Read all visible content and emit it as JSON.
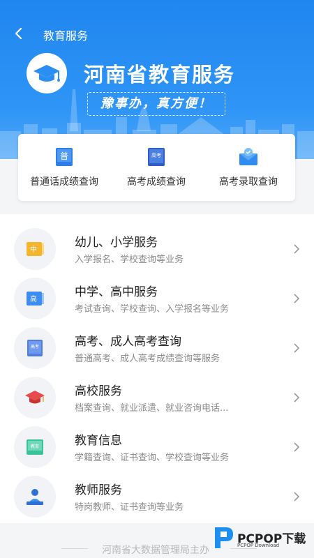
{
  "header": {
    "back": "back-arrow-icon",
    "title": "教育服务"
  },
  "banner": {
    "title": "河南省教育服务",
    "slogan": "豫事办，真方便！",
    "logo": "graduation-cap-icon"
  },
  "quick_links": [
    {
      "label": "普通话成绩查询",
      "icon": "mandarin-book-icon",
      "icon_text": "普"
    },
    {
      "label": "高考成绩查询",
      "icon": "exam-book-icon",
      "icon_text": "高考"
    },
    {
      "label": "高考录取查询",
      "icon": "envelope-check-icon"
    }
  ],
  "services": [
    {
      "title": "幼儿、小学服务",
      "subtitle": "入学报名、学校查询等业务",
      "icon": "primary-school-icon",
      "icon_text": "中"
    },
    {
      "title": "中学、高中服务",
      "subtitle": "考试查询、学校查询、入学报名等业务",
      "icon": "high-school-icon",
      "icon_text": "高"
    },
    {
      "title": "高考、成人高考查询",
      "subtitle": "普通高考、成人高考成绩查询等服务",
      "icon": "exam-book-icon",
      "icon_text": "高考"
    },
    {
      "title": "高校服务",
      "subtitle": "档案查询、就业派遣、就业咨询电话...",
      "icon": "graduation-cap-icon"
    },
    {
      "title": "教育信息",
      "subtitle": "学籍查询、证书查询、学校查询等业务",
      "icon": "info-book-icon",
      "icon_text": "教育"
    },
    {
      "title": "教师服务",
      "subtitle": "特岗教师、证书查询等业务",
      "icon": "teacher-icon"
    }
  ],
  "footer": "河南省大数据管理局主办",
  "watermark": {
    "brand": "PCPOP下载",
    "sub": "PCPOP Download"
  },
  "colors": {
    "primary": "#1f86f0",
    "text": "#222222",
    "subtext": "#8b8b8b"
  }
}
